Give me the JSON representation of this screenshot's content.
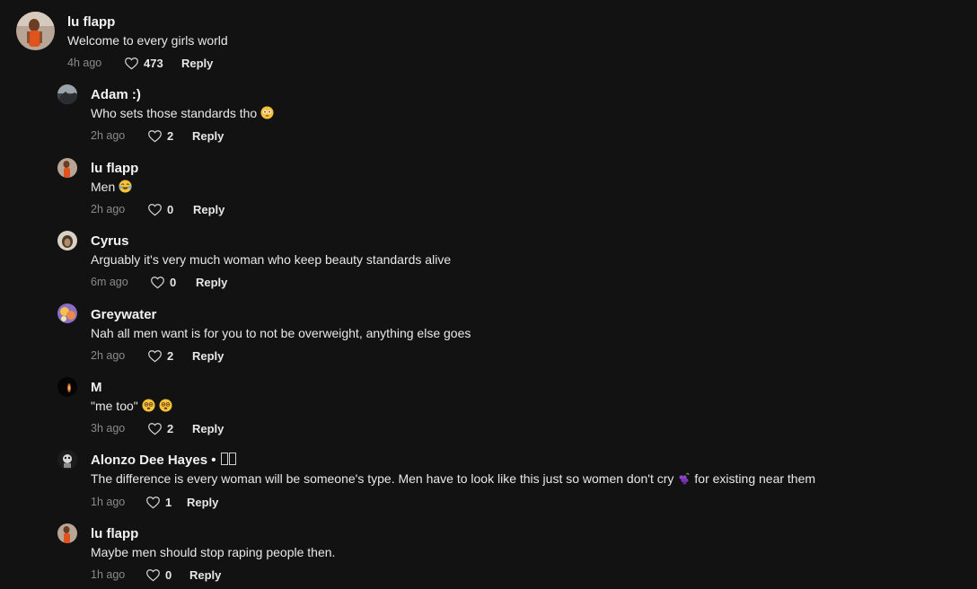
{
  "comments": [
    {
      "username": "lu  flapp",
      "text": "Welcome to every girls world",
      "time": "4h ago",
      "likes": "473",
      "reply_label": "Reply"
    },
    {
      "username": "Adam :)",
      "text": "Who sets those standards tho",
      "emoji": "flushed-face",
      "time": "2h ago",
      "likes": "2",
      "reply_label": "Reply"
    },
    {
      "username": "lu  flapp",
      "text": "Men",
      "emoji": "laughing-face",
      "time": "2h ago",
      "likes": "0",
      "reply_label": "Reply"
    },
    {
      "username": "Cyrus",
      "text": "Arguably it's very much woman who keep beauty standards alive",
      "time": "6m ago",
      "likes": "0",
      "reply_label": "Reply"
    },
    {
      "username": "Greywater",
      "text": "Nah all men want is for you to not be overweight, anything else goes",
      "time": "2h ago",
      "likes": "2",
      "reply_label": "Reply"
    },
    {
      "username": "M",
      "text": "\"me too\"",
      "emoji": "swirl-eyes-face",
      "time": "3h ago",
      "likes": "2",
      "reply_label": "Reply"
    },
    {
      "username": "Alonzo Dee Hayes",
      "username_suffix": " •",
      "text_before": "The difference is every woman will be someone's type. Men have to look like this just so women don't cry",
      "text_after": "for existing near them",
      "emoji": "grapes",
      "time": "1h ago",
      "likes": "1",
      "reply_label": "Reply"
    },
    {
      "username": "lu  flapp",
      "text": "Maybe men should stop raping people then.",
      "time": "1h ago",
      "likes": "0",
      "reply_label": "Reply"
    }
  ],
  "colors": {
    "background": "#121212",
    "meta_text": "#8a8a8a",
    "primary_text": "#ffffff"
  }
}
